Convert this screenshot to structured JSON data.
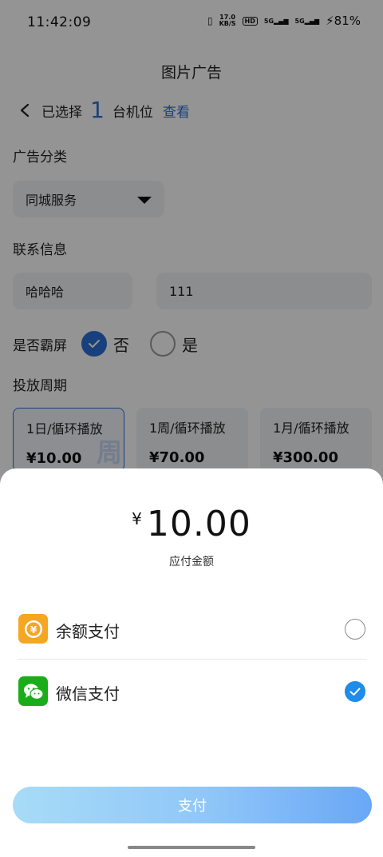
{
  "status_bar": {
    "time": "11:42:09",
    "net_speed_value": "17.0",
    "net_speed_unit": "KB/S",
    "hd_badge": "HD",
    "signal1_label": "5G",
    "signal2_label": "5G",
    "battery": "81%"
  },
  "page": {
    "title": "图片广告",
    "selection": {
      "prefix": "已选择",
      "count": "1",
      "suffix": "台机位",
      "view_link": "查看"
    },
    "category_label": "广告分类",
    "category_value": "同城服务",
    "contact_label": "联系信息",
    "contact_name": "哈哈哈",
    "contact_phone": "111",
    "fullscreen_label": "是否霸屏",
    "fullscreen_options": [
      "否",
      "是"
    ],
    "fullscreen_selected": "否",
    "period_label": "投放周期",
    "plans": [
      {
        "name": "1日/循环播放",
        "price": "¥10.00",
        "watermark": "周",
        "selected": true
      },
      {
        "name": "1周/循环播放",
        "price": "¥70.00",
        "watermark": "",
        "selected": false
      },
      {
        "name": "1月/循环播放",
        "price": "¥300.00",
        "watermark": "",
        "selected": false
      }
    ]
  },
  "sheet": {
    "currency": "¥",
    "amount": "10.00",
    "amount_label": "应付金额",
    "methods": [
      {
        "name": "余额支付",
        "icon": "balance-yen-icon",
        "icon_color": "#f5a623",
        "selected": false
      },
      {
        "name": "微信支付",
        "icon": "wechat-icon",
        "icon_color": "#1aad19",
        "selected": true
      }
    ],
    "pay_button": "支付"
  },
  "colors": {
    "accent_blue": "#2a6fd6",
    "check_blue": "#1e8ce8",
    "overlay": "rgba(0,0,0,0.42)"
  }
}
